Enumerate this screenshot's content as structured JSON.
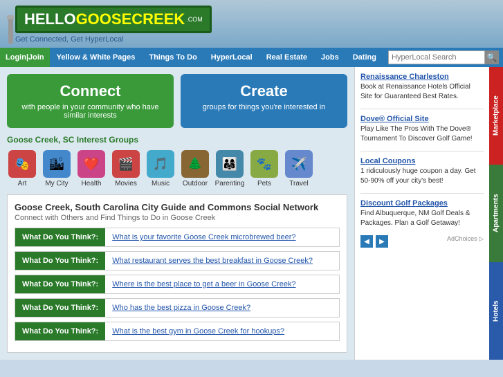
{
  "header": {
    "brand_hello": "HELLO",
    "brand_name": "GOOSECREEK",
    "brand_tld": ".COM",
    "tagline": "Get Connected, Get HyperLocal"
  },
  "nav": {
    "login_label": "Login",
    "join_label": "Join",
    "items": [
      {
        "label": "Yellow & White Pages"
      },
      {
        "label": "Things To Do"
      },
      {
        "label": "HyperLocal"
      },
      {
        "label": "Real Estate"
      },
      {
        "label": "Jobs"
      },
      {
        "label": "Dating"
      }
    ],
    "search_placeholder": "HyperLocal Search"
  },
  "connect_box": {
    "title": "Connect",
    "desc": "with people in your community who have similar interests"
  },
  "create_box": {
    "title": "Create",
    "desc": "groups for things you're interested in"
  },
  "interest_groups": {
    "title": "Goose Creek, SC Interest Groups",
    "items": [
      {
        "label": "Art",
        "icon": "🎭",
        "color": "#cc4444"
      },
      {
        "label": "My City",
        "icon": "🏙",
        "color": "#4488cc"
      },
      {
        "label": "Health",
        "icon": "❤️",
        "color": "#cc4488"
      },
      {
        "label": "Movies",
        "icon": "🎬",
        "color": "#cc4444"
      },
      {
        "label": "Music",
        "icon": "🎵",
        "color": "#44aacc"
      },
      {
        "label": "Outdoor",
        "icon": "🌲",
        "color": "#886633"
      },
      {
        "label": "Parenting",
        "icon": "👨‍👩‍👧",
        "color": "#4488aa"
      },
      {
        "label": "Pets",
        "icon": "🐾",
        "color": "#88aa44"
      },
      {
        "label": "Travel",
        "icon": "✈️",
        "color": "#6688cc"
      }
    ]
  },
  "city_guide": {
    "title": "Goose Creek, South Carolina City Guide and Commons Social Network",
    "subtitle": "Connect with Others and Find Things to Do in Goose Creek",
    "questions": [
      {
        "label": "What Do You Think?:",
        "link": "What is your favorite Goose Creek microbrewed beer?"
      },
      {
        "label": "What Do You Think?:",
        "link": "What restaurant serves the best breakfast in Goose Creek?"
      },
      {
        "label": "What Do You Think?:",
        "link": "Where is the best place to get a beer in Goose Creek?"
      },
      {
        "label": "What Do You Think?:",
        "link": "Who has the best pizza in Goose Creek?"
      },
      {
        "label": "What Do You Think?:",
        "link": "What is the best gym in Goose Creek for hookups?"
      }
    ]
  },
  "ads": [
    {
      "title": "Renaissance Charleston",
      "desc": "Book at Renaissance Hotels Official Site for Guaranteed Best Rates."
    },
    {
      "title": "Dove® Official Site",
      "desc": "Play Like The Pros With The Dove® Tournament To Discover Golf Game!"
    },
    {
      "title": "Local Coupons",
      "desc": "1 ridiculously huge coupon a day. Get 50-90% off your city's best!"
    },
    {
      "title": "Discount Golf Packages",
      "desc": "Find Albuquerque, NM Golf Deals & Packages. Plan a Golf Getaway!"
    }
  ],
  "ad_choices": "AdChoices ▷",
  "right_tabs": [
    {
      "label": "Marketplace",
      "color": "#cc2222"
    },
    {
      "label": "Apartments",
      "color": "#3a7a3a"
    },
    {
      "label": "Hotels",
      "color": "#2a5aaa"
    }
  ]
}
